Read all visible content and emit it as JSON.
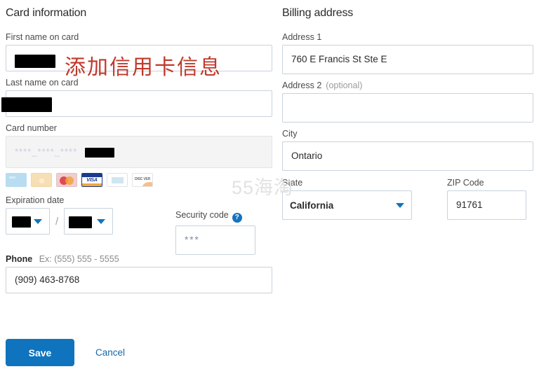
{
  "annotation": {
    "text": "添加信用卡信息",
    "color": "#c0392b"
  },
  "watermark": {
    "text": "55海淘"
  },
  "card_section": {
    "title": "Card information",
    "first_name": {
      "label": "First name on card",
      "value": "",
      "redacted": true
    },
    "last_name": {
      "label": "Last name on card",
      "value": "",
      "redacted": true
    },
    "card_number": {
      "label": "Card number",
      "masked_value": "****_****_****",
      "redacted": true
    },
    "card_brands": [
      {
        "name": "generic-card-icon",
        "label": ""
      },
      {
        "name": "amex-card-icon",
        "label": ""
      },
      {
        "name": "mastercard-card-icon",
        "label": ""
      },
      {
        "name": "visa-card-icon",
        "label": "VISA"
      },
      {
        "name": "faded-card-icon",
        "label": ""
      },
      {
        "name": "discover-card-icon",
        "label": "DISC VER"
      }
    ],
    "expiration": {
      "label": "Expiration date",
      "month_value": "",
      "year_value": "",
      "separator": "/"
    },
    "security_code": {
      "label": "Security code",
      "help_glyph": "?",
      "value": "***"
    },
    "phone": {
      "label": "Phone",
      "hint": "Ex: (555) 555 - 5555",
      "value": "(909) 463-8768"
    }
  },
  "billing_section": {
    "title": "Billing address",
    "address1": {
      "label": "Address 1",
      "value": "760 E Francis St Ste E"
    },
    "address2": {
      "label": "Address 2",
      "optional": "(optional)",
      "value": ""
    },
    "city": {
      "label": "City",
      "value": "Ontario"
    },
    "state": {
      "label": "State",
      "value": "California"
    },
    "zip": {
      "label": "ZIP Code",
      "value": "91761"
    }
  },
  "actions": {
    "save_label": "Save",
    "cancel_label": "Cancel",
    "accent_color": "#0f74bd"
  }
}
